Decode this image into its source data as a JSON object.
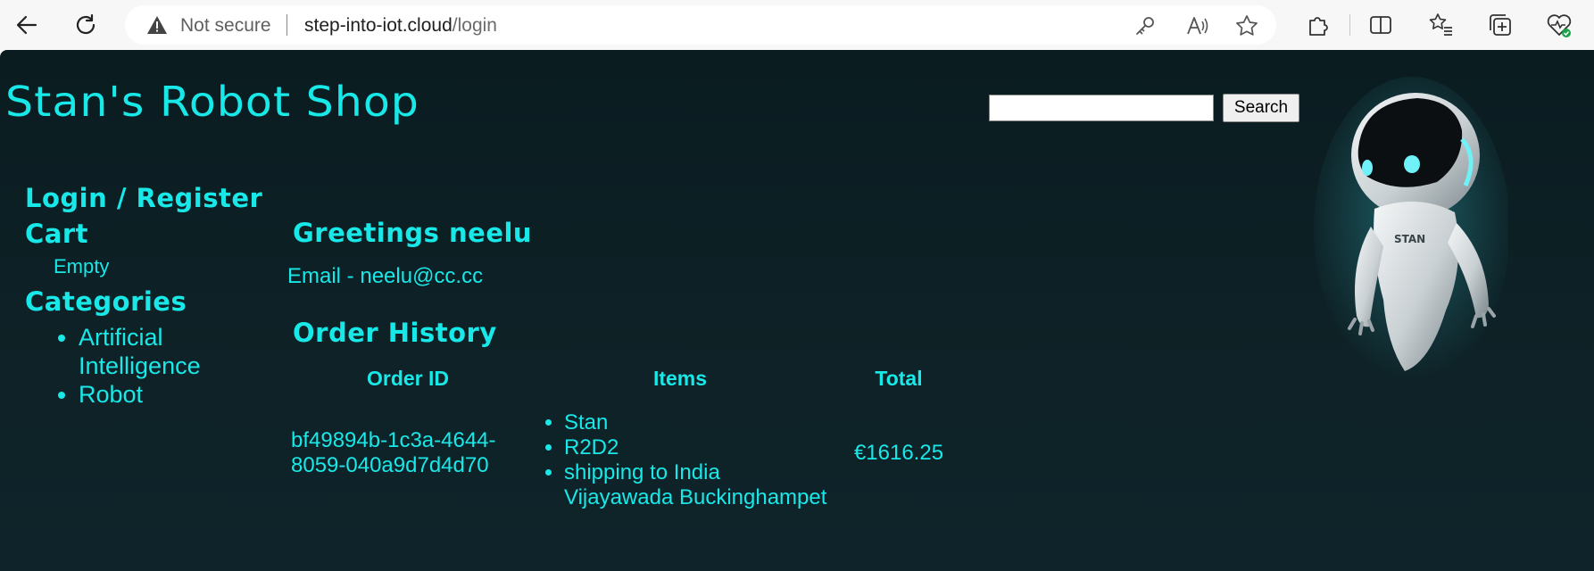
{
  "browser": {
    "security_label": "Not secure",
    "url_host": "step-into-iot.cloud",
    "url_path": "/login"
  },
  "header": {
    "site_title": "Stan's Robot Shop",
    "search_placeholder": "",
    "search_button": "Search",
    "robot_chest_label": "STAN"
  },
  "sidebar": {
    "login_register": "Login / Register",
    "cart_heading": "Cart",
    "cart_status": "Empty",
    "categories_heading": "Categories",
    "categories": [
      "Artificial Intelligence",
      "Robot"
    ]
  },
  "account": {
    "greeting": "Greetings neelu",
    "email": "Email - neelu@cc.cc"
  },
  "order_history": {
    "heading": "Order History",
    "columns": [
      "Order ID",
      "Items",
      "Total"
    ],
    "rows": [
      {
        "order_id": "bf49894b-1c3a-4644-8059-040a9d7d4d70",
        "items": [
          "Stan",
          "R2D2",
          "shipping to India Vijayawada Buckinghampet"
        ],
        "total": "€1616.25"
      }
    ]
  },
  "colors": {
    "accent": "#19e8e8",
    "page_bg": "#0d2125",
    "chrome_bg": "#f7f7f7"
  }
}
